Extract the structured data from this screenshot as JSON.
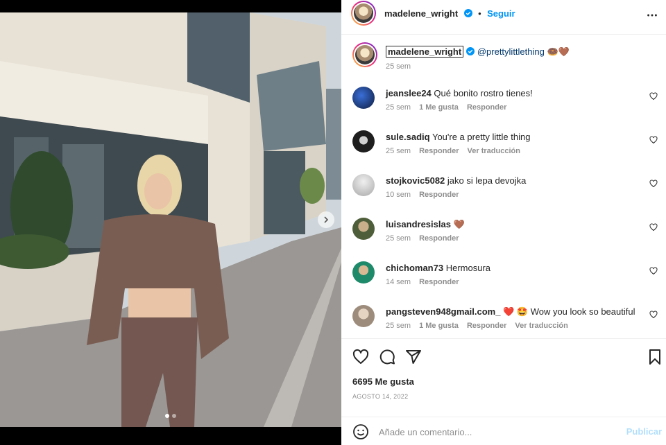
{
  "post": {
    "author": "madelene_wright",
    "follow_label": "Seguir",
    "caption": {
      "username": "madelene_wright",
      "mention": "@prettylittlething",
      "emoji": "🍩🤎",
      "time": "25 sem"
    },
    "comments": [
      {
        "user": "jeanslee24",
        "text": "Qué bonito rostro tienes!",
        "time": "25 sem",
        "likes": "1 Me gusta",
        "reply": "Responder",
        "translate": "",
        "avatar_color": "#1a3a8a"
      },
      {
        "user": "sule.sadiq",
        "text": "You're a pretty little thing",
        "time": "25 sem",
        "likes": "",
        "reply": "Responder",
        "translate": "Ver traducción",
        "avatar_color": "#2b2b2b"
      },
      {
        "user": "stojkovic5082",
        "text": "jako si lepa devojka",
        "time": "10 sem",
        "likes": "",
        "reply": "Responder",
        "translate": "",
        "avatar_color": "#cfcfcf"
      },
      {
        "user": "luisandresislas",
        "text": "🤎",
        "time": "25 sem",
        "likes": "",
        "reply": "Responder",
        "translate": "",
        "avatar_color": "#6b7a4a"
      },
      {
        "user": "chichoman73",
        "text": "Hermosura",
        "time": "14 sem",
        "likes": "",
        "reply": "Responder",
        "translate": "",
        "avatar_color": "#1f8a6a"
      },
      {
        "user": "pangsteven948gmail.com_",
        "text": "❤️ 🤩 Wow you look so beautiful",
        "time": "25 sem",
        "likes": "1 Me gusta",
        "reply": "Responder",
        "translate": "Ver traducción",
        "avatar_color": "#b8a89a"
      }
    ],
    "likes_count": "6695 Me gusta",
    "date": "AGOSTO 14, 2022",
    "comment_placeholder": "Añade un comentario...",
    "publish_label": "Publicar"
  },
  "icons": {
    "more": "more-horizontal-icon",
    "like": "heart-icon",
    "comment": "comment-icon",
    "share": "send-icon",
    "save": "bookmark-icon",
    "emoji": "emoji-icon",
    "next": "chevron-right-icon"
  },
  "colors": {
    "accent": "#0095f6",
    "publish_disabled": "#b2dffc",
    "mention": "#00376b",
    "muted": "#8e8e8e"
  }
}
